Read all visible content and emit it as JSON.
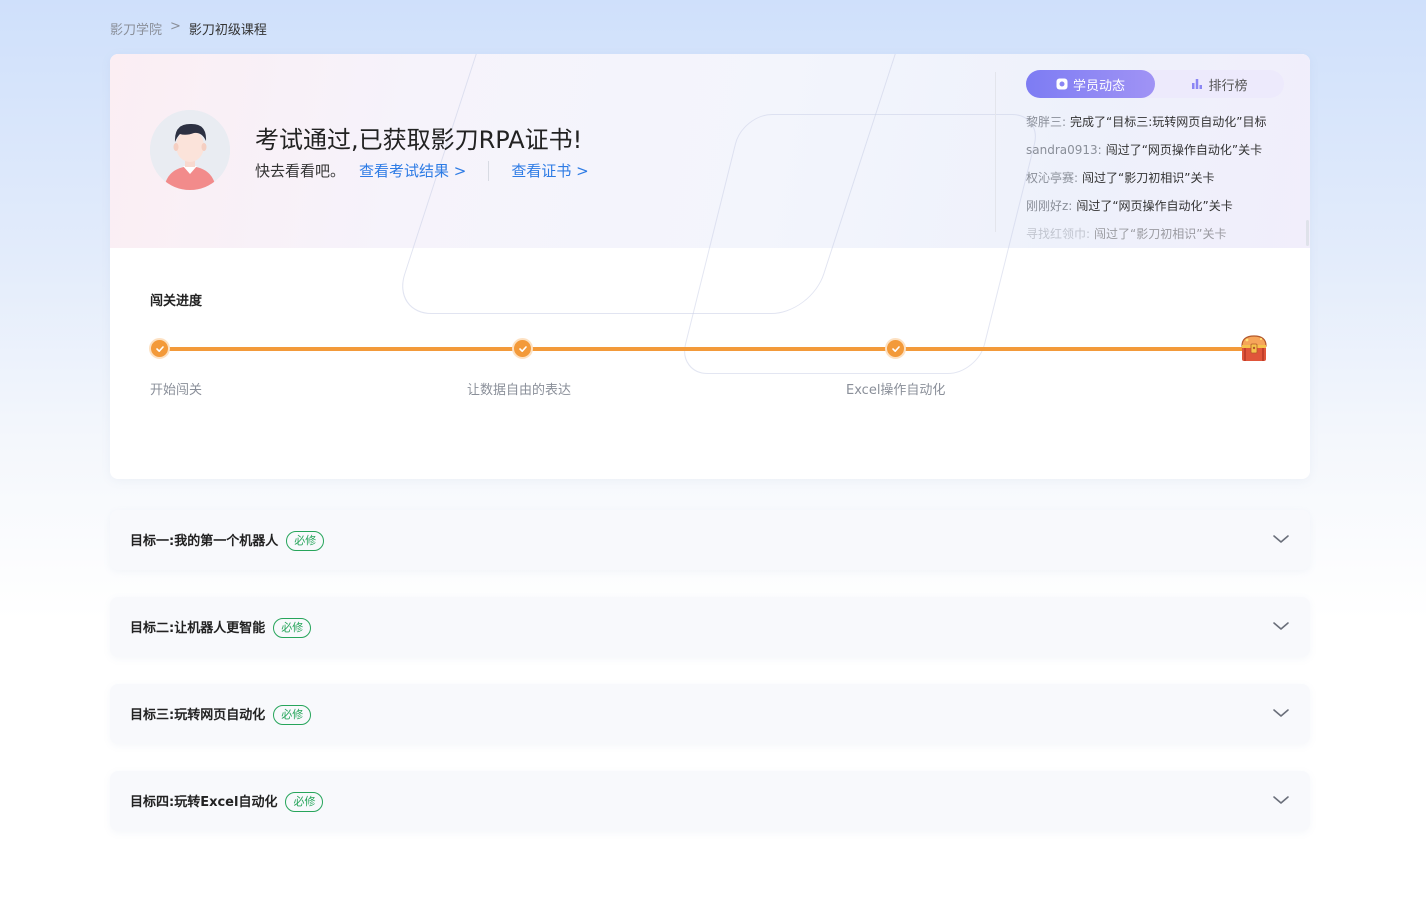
{
  "breadcrumb": {
    "root": "影刀学院",
    "separator": ">",
    "current": "影刀初级课程"
  },
  "hero": {
    "title": "考试通过,已获取影刀RPA证书!",
    "hint": "快去看看吧。",
    "view_result_link": "查看考试结果 >",
    "view_cert_link": "查看证书 >"
  },
  "feed": {
    "tabs": [
      {
        "label": "学员动态",
        "icon": "activity-icon",
        "active": true
      },
      {
        "label": "排行榜",
        "icon": "bar-chart-icon",
        "active": false
      }
    ],
    "items": [
      {
        "user": "黎胖三:",
        "text": "完成了“目标三:玩转网页自动化”目标"
      },
      {
        "user": "sandra0913:",
        "text": "闯过了“网页操作自动化”关卡"
      },
      {
        "user": "权沁亭赛:",
        "text": "闯过了“影刀初相识”关卡"
      },
      {
        "user": "刚刚好z:",
        "text": "闯过了“网页操作自动化”关卡"
      },
      {
        "user": "寻找红领巾:",
        "text": "闯过了“影刀初相识”关卡"
      }
    ]
  },
  "progress": {
    "title": "闯关进度",
    "stages": [
      {
        "label": "开始闯关",
        "done": true
      },
      {
        "label": "让数据自由的表达",
        "done": true
      },
      {
        "label": "Excel操作自动化",
        "done": true
      }
    ],
    "reward_icon": "treasure-chest-icon"
  },
  "goals": [
    {
      "title": "目标一:我的第一个机器人",
      "badge": "必修"
    },
    {
      "title": "目标二:让机器人更智能",
      "badge": "必修"
    },
    {
      "title": "目标三:玩转网页自动化",
      "badge": "必修"
    },
    {
      "title": "目标四:玩转Excel自动化",
      "badge": "必修"
    }
  ],
  "colors": {
    "accent_orange": "#f39a3a",
    "link_blue": "#2d7be5",
    "badge_green": "#27a55b",
    "tab_purple": "#7d7cf3"
  }
}
